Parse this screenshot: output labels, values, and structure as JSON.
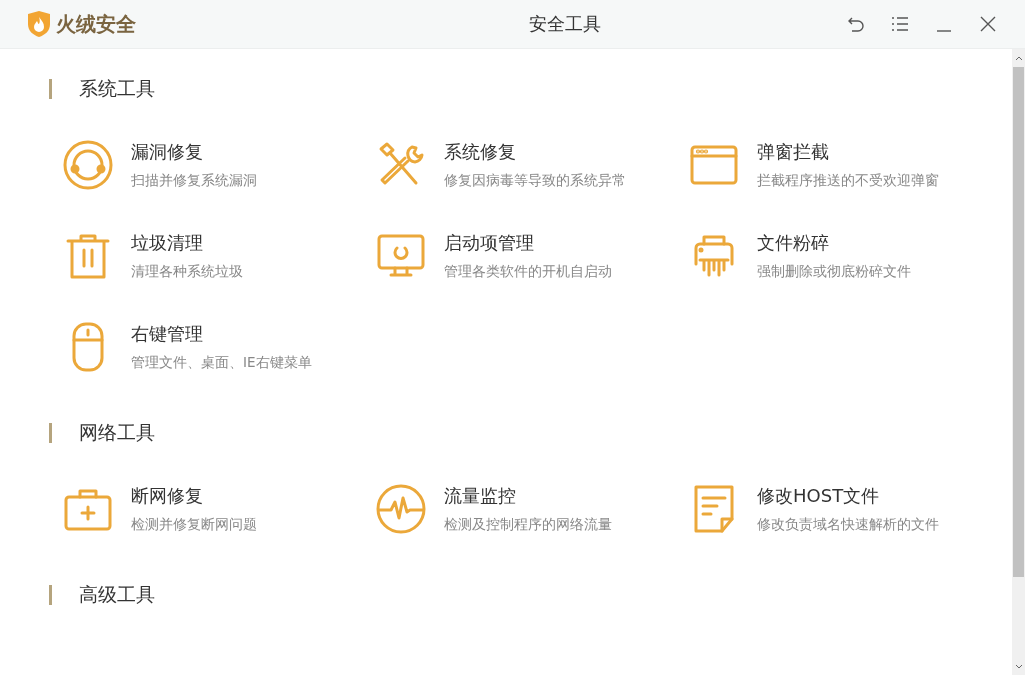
{
  "window": {
    "app_name": "火绒安全",
    "title": "安全工具"
  },
  "sections": [
    {
      "heading": "系统工具",
      "items": [
        {
          "title": "漏洞修复",
          "description": "扫描并修复系统漏洞"
        },
        {
          "title": "系统修复",
          "description": "修复因病毒等导致的系统异常"
        },
        {
          "title": "弹窗拦截",
          "description": "拦截程序推送的不受欢迎弹窗"
        },
        {
          "title": "垃圾清理",
          "description": "清理各种系统垃圾"
        },
        {
          "title": "启动项管理",
          "description": "管理各类软件的开机自启动"
        },
        {
          "title": "文件粉碎",
          "description": "强制删除或彻底粉碎文件"
        },
        {
          "title": "右键管理",
          "description": "管理文件、桌面、IE右键菜单"
        }
      ]
    },
    {
      "heading": "网络工具",
      "items": [
        {
          "title": "断网修复",
          "description": "检测并修复断网问题"
        },
        {
          "title": "流量监控",
          "description": "检测及控制程序的网络流量"
        },
        {
          "title": "修改HOST文件",
          "description": "修改负责域名快速解析的文件"
        }
      ]
    },
    {
      "heading": "高级工具"
    }
  ]
}
